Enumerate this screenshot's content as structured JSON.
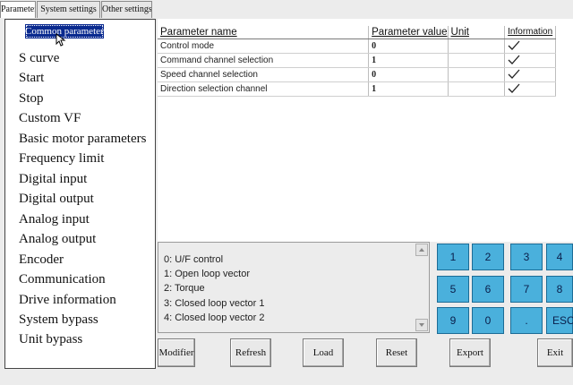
{
  "tabs": [
    {
      "label": "Parameters",
      "active": true
    },
    {
      "label": "System settings",
      "active": false
    },
    {
      "label": "Other settings",
      "active": false
    }
  ],
  "sidebar": {
    "selected": "Common parameters",
    "items": [
      "S curve",
      "Start",
      "Stop",
      "Custom VF",
      "Basic motor parameters",
      "Frequency limit",
      "Digital input",
      "Digital output",
      "Analog input",
      "Analog output",
      "Encoder",
      "Communication",
      "Drive information",
      "System bypass",
      "Unit bypass"
    ]
  },
  "table": {
    "headers": {
      "name": "Parameter name",
      "value": "Parameter value",
      "unit": "Unit",
      "info": "Information"
    },
    "rows": [
      {
        "name": "Control mode",
        "value": "0",
        "unit": "",
        "info": "checkmark-icon"
      },
      {
        "name": "Command channel selection",
        "value": "1",
        "unit": "",
        "info": "checkmark-icon"
      },
      {
        "name": "Speed channel selection",
        "value": "0",
        "unit": "",
        "info": "checkmark-icon"
      },
      {
        "name": "Direction selection channel",
        "value": "1",
        "unit": "",
        "info": "checkmark-icon"
      }
    ]
  },
  "options": [
    "0: U/F control",
    "1: Open loop vector",
    "2: Torque",
    "3: Closed loop vector 1",
    "4: Closed loop vector 2"
  ],
  "keypad": {
    "keys": [
      "1",
      "2",
      "3",
      "4",
      "5",
      "6",
      "7",
      "8",
      "9",
      "0",
      ".",
      "ESC"
    ],
    "color": "#4ab0dc"
  },
  "buttons": [
    "Modifier",
    "Refresh",
    "Load",
    "Reset",
    "Export",
    "Exit"
  ],
  "icons": {
    "cursor": "mouse-pointer-icon",
    "scroll_up": "arrow-up-icon",
    "scroll_down": "arrow-down-icon"
  }
}
